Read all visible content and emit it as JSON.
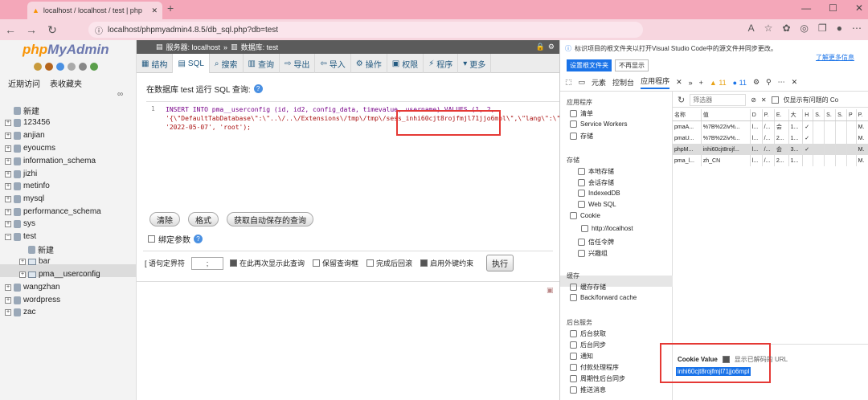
{
  "browser": {
    "tab_title": "localhost / localhost / test | php",
    "url": "localhost/phpmyadmin4.8.5/db_sql.php?db=test"
  },
  "sidebar": {
    "logo_php": "php",
    "logo_myadmin": "MyAdmin",
    "links": [
      "近期访问",
      "表收藏夹"
    ],
    "tree": [
      {
        "label": "新建",
        "type": "new"
      },
      {
        "label": "123456",
        "type": "db"
      },
      {
        "label": "anjian",
        "type": "db"
      },
      {
        "label": "eyoucms",
        "type": "db"
      },
      {
        "label": "information_schema",
        "type": "db"
      },
      {
        "label": "jizhi",
        "type": "db"
      },
      {
        "label": "metinfo",
        "type": "db"
      },
      {
        "label": "mysql",
        "type": "db"
      },
      {
        "label": "performance_schema",
        "type": "db"
      },
      {
        "label": "sys",
        "type": "db"
      },
      {
        "label": "test",
        "type": "db"
      },
      {
        "label": "新建",
        "type": "new-sub"
      },
      {
        "label": "bar",
        "type": "table"
      },
      {
        "label": "pma__userconfig",
        "type": "table"
      },
      {
        "label": "wangzhan",
        "type": "db"
      },
      {
        "label": "wordpress",
        "type": "db"
      },
      {
        "label": "zac",
        "type": "db"
      }
    ]
  },
  "main": {
    "breadcrumb_server": "服务器: localhost",
    "breadcrumb_db": "数据库: test",
    "tabs": [
      "结构",
      "SQL",
      "搜索",
      "查询",
      "导出",
      "导入",
      "操作",
      "权限",
      "程序",
      "更多"
    ],
    "sql_heading": "在数据库 test 运行 SQL 查询:",
    "code_line1": "INSERT INTO pma__userconfig (id, id2, config_data, timevalue, username) VALUES (1, 2,",
    "code_line2": "'{\\\"DefaultTabDatabase\\\":\\\"..\\/..\\/Extensions\\/tmp\\/tmp\\/sess_inhi60cjt8rojfmjl71jjo6mpl\\\",\\\"lang\\\":\\\"zh_CN",
    "code_line3": "'2022-05-07', 'root');",
    "buttons": [
      "清除",
      "格式",
      "获取自动保存的查询"
    ],
    "bind_params": "绑定参数",
    "delimiter_label": "[ 语句定界符",
    "delimiter_value": ";",
    "options": [
      {
        "label": "在此再次显示此查询",
        "checked": true
      },
      {
        "label": "保留查询框",
        "checked": false
      },
      {
        "label": "完成后回滚",
        "checked": false
      },
      {
        "label": "启用外键约束",
        "checked": true
      }
    ],
    "execute": "执行"
  },
  "devtools": {
    "banner": "标识项目的根文件夹以打开Visual Studio Code中的源文件并同步更改。",
    "learn_more": "了解更多信息",
    "btn_set_root": "设置根文件夹",
    "btn_dismiss": "不再显示",
    "tabs": [
      "元素",
      "控制台",
      "应用程序"
    ],
    "warn_count": "11",
    "info_count": "11",
    "sections": {
      "app": "应用程序",
      "storage": "存储",
      "cache": "缓存",
      "bg": "后台服务"
    },
    "app_items": [
      "清单",
      "Service Workers",
      "存储"
    ],
    "storage_items": [
      "本地存储",
      "会话存储",
      "IndexedDB",
      "Web SQL",
      "Cookie",
      "http://localhost",
      "信任令牌",
      "兴趣组"
    ],
    "cache_items": [
      "缓存存储",
      "Back/forward cache"
    ],
    "bg_items": [
      "后台获取",
      "后台同步",
      "通知",
      "付款处理程序",
      "周期性后台同步",
      "推送消息"
    ],
    "filter_placeholder": "筛选器",
    "only_issues": "仅显示有问题的 Co",
    "columns": [
      "名称",
      "值",
      "D",
      "P.",
      "E.",
      "大",
      "H",
      "S.",
      "S.",
      "S.",
      "P",
      "P."
    ],
    "rows": [
      [
        "pmaA...",
        "%7B%22iv%...",
        "l...",
        "/...",
        "会",
        "1...",
        "✓",
        "",
        "",
        "",
        "",
        "M."
      ],
      [
        "pmaU...",
        "%7B%22iv%...",
        "l...",
        "/...",
        "2...",
        "1...",
        "✓",
        "",
        "",
        "",
        "",
        "M."
      ],
      [
        "phpM...",
        "inhi60cjt8rojf...",
        "l...",
        "/...",
        "会",
        "3...",
        "✓",
        "",
        "",
        "",
        "",
        "M."
      ],
      [
        "pma_l...",
        "zh_CN",
        "l...",
        "/...",
        "2...",
        "1...",
        "",
        "",
        "",
        "",
        "",
        "M."
      ]
    ],
    "cookie_value_label": "Cookie Value",
    "decoded_label": "显示已解码的 URL",
    "cookie_value": "inhi60cjt8rojfmjl71jjo6mpl"
  },
  "colors": {
    "titlebar": "#f4a7b9",
    "accent": "#1a73e8",
    "highlight": "#e53935"
  }
}
